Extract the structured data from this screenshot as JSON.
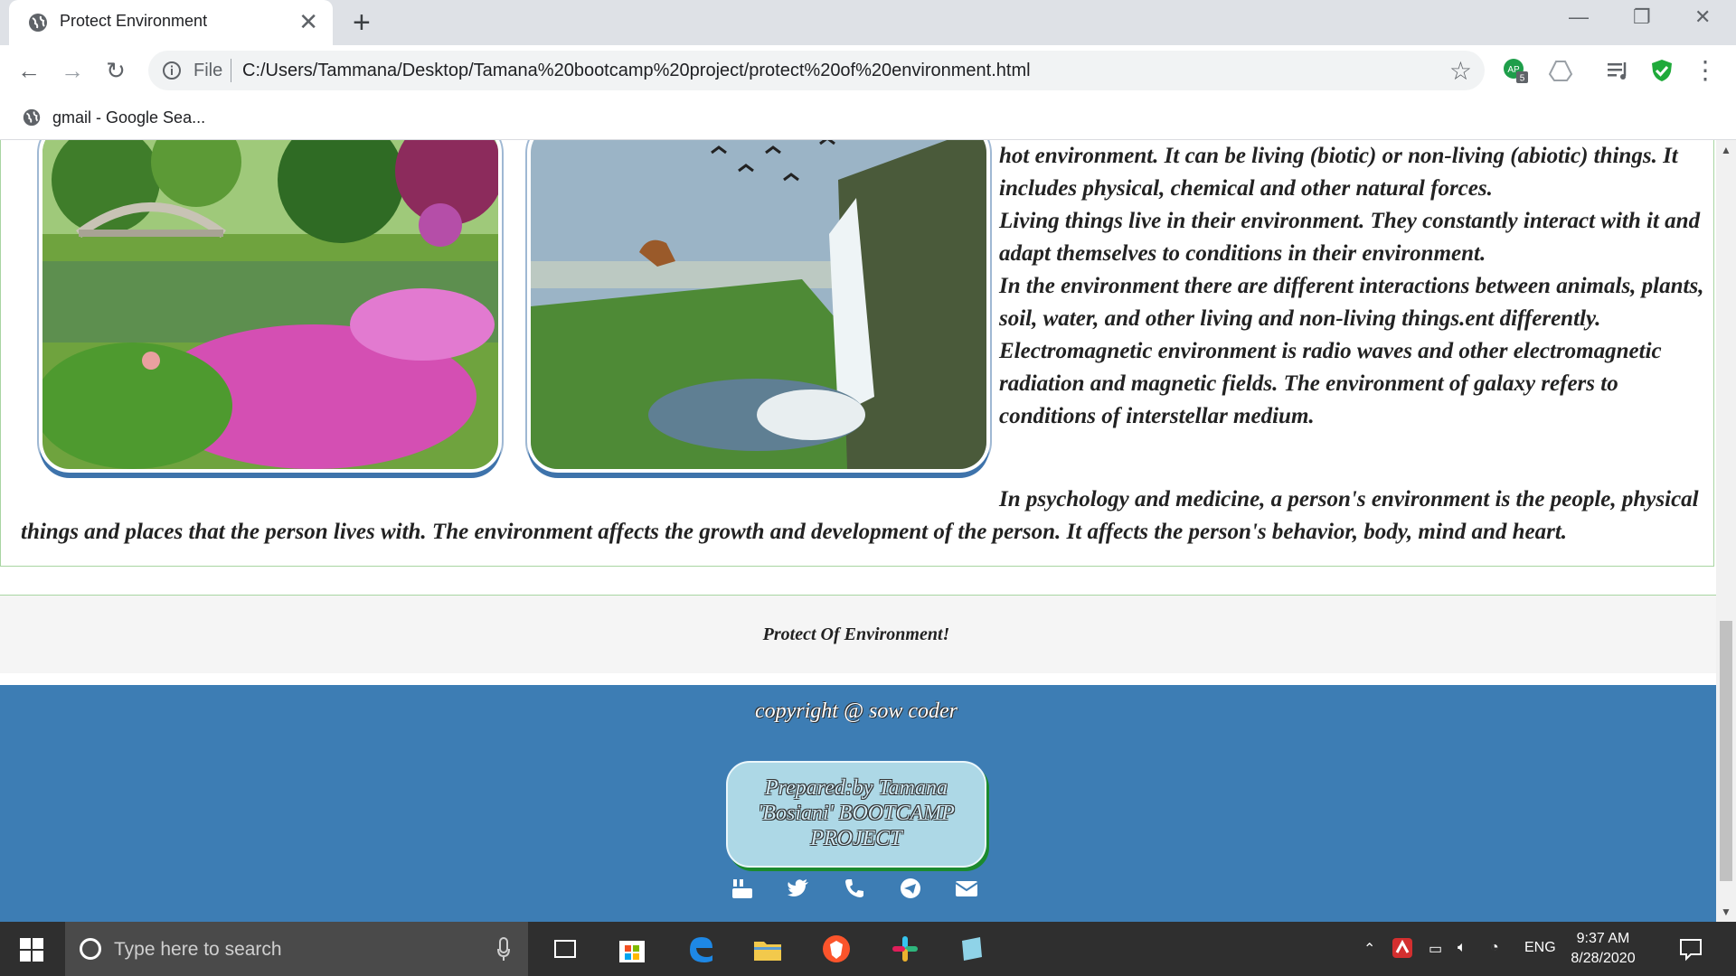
{
  "browser": {
    "tab_title": "Protect Environment",
    "tab_close": "✕",
    "new_tab": "+",
    "window_controls": [
      "—",
      "❐",
      "✕"
    ],
    "url_scheme": "File",
    "url": "C:/Users/Tammana/Desktop/Tamana%20bootcamp%20project/protect%20of%20environment.html",
    "extension_badge": "5",
    "extension_label": "AP",
    "bookmark": "gmail - Google Sea..."
  },
  "article": {
    "paragraphs": [
      "hot environment. It can be living (biotic) or non-living (abiotic) things. It includes physical, chemical and other natural forces.",
      "Living things live in their environment. They constantly interact with it and adapt themselves to conditions in their environment.",
      "In the environment there are different interactions between animals, plants, soil, water, and other living and non-living things.ent differently.",
      "Electromagnetic environment is radio waves and other electromagnetic radiation and magnetic fields. The environment of galaxy refers to conditions of interstellar medium."
    ],
    "wide_paragraph": "In psychology and medicine, a person's environment is the people, physical things and places that the person lives with. The environment affects the growth and development of the person. It affects the person's behavior, body, mind and heart.",
    "images": [
      "garden-photo",
      "waterfall-photo"
    ]
  },
  "footer": {
    "protect_title": "Protect Of Environment!",
    "copyright": "copyright @ sow coder",
    "prepared": "Prepared:by Tamana 'Bosiani' BOOTCAMP PROJECT",
    "social_icons": [
      "youtube-icon",
      "twitter-icon",
      "phone-icon",
      "telegram-icon",
      "mail-icon"
    ]
  },
  "taskbar": {
    "search_placeholder": "Type here to search",
    "language": "ENG",
    "time": "9:37 AM",
    "date": "8/28/2020"
  },
  "colors": {
    "footer_blue": "#3d7db4",
    "card_blue": "#add8e6",
    "border_green": "#a8d5a2"
  }
}
